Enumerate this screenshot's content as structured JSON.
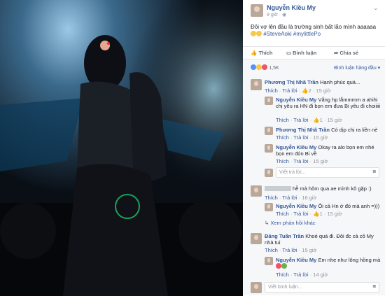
{
  "post": {
    "author": "Nguyễn Kiều My",
    "time": "9 giờ",
    "text": "Đôi vợ lên đầu là trường sinh bất lão mình aaaaaa",
    "hashtags": "#SteveAoki #mylittlePo",
    "actions": {
      "like": "Thích",
      "comment": "Bình luận",
      "share": "Chia sẻ"
    },
    "reactions_count": "1,5K",
    "sort_label": "Bình luận hàng đầu"
  },
  "labels": {
    "like": "Thích",
    "reply": "Trả lời",
    "reply_placeholder": "Viết trả lời...",
    "comment_placeholder": "Viết bình luận..."
  },
  "comments": [
    {
      "author": "Phương Thị Nhã Trần",
      "text": "Hạnh phúc quá...",
      "likes": "2",
      "time": "15 giờ"
    },
    {
      "author": "Nguyễn Kiều My",
      "text": "Vắng hp lắmmmm a ahihi chị yêu ra HN đi bọn em đưa Bi yêu đi choiiiii",
      "likes": "1",
      "time": "15 giờ"
    },
    {
      "author": "Phương Thị Nhã Trần",
      "text": "Có dịp chị ra liền nè",
      "time": "15 giờ"
    },
    {
      "author": "Nguyễn Kiều My",
      "text": "Okay ra alo bọn em nhé bọn em đón Bi về",
      "time": "15 giờ"
    },
    {
      "author": "",
      "text": "hễ mà hôm qua ae mình kô gặp :)",
      "time": "16 giờ"
    },
    {
      "author": "Nguyễn Kiều My",
      "text": "Ôi cả Hn ở đó mà anh =)))",
      "likes": "1",
      "time": "15 giờ"
    },
    {
      "author": "Đăng Tuấn Trần",
      "text": "Khoẻ quá đi. Đôi đc cả cô My nhà tui",
      "time": "15 giờ"
    },
    {
      "author": "Nguyễn Kiều My",
      "text": "Em nhẹ như lông hồng mà",
      "time": "14 giờ"
    }
  ],
  "more_replies": "Xem phản hồi khác"
}
